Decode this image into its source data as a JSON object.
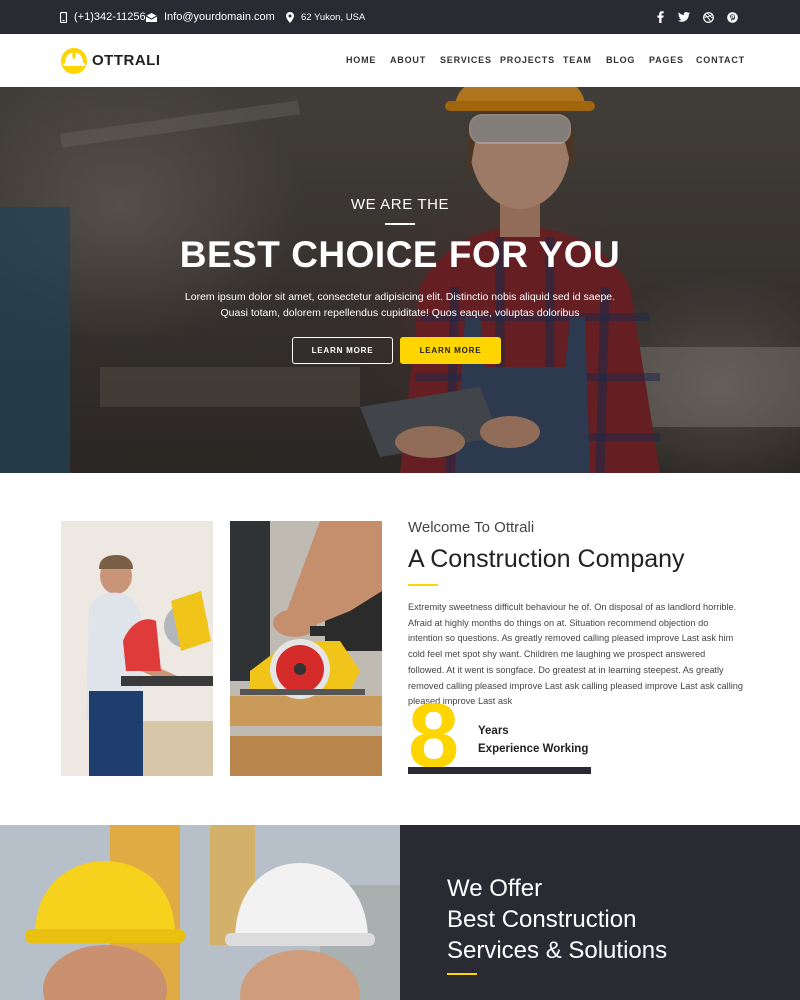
{
  "topbar": {
    "phone": "(+1)342-11256",
    "email": "Info@yourdomain.com",
    "address": "62 Yukon, USA",
    "social_icons": [
      "facebook-icon",
      "twitter-icon",
      "dribbble-icon",
      "pinterest-icon"
    ]
  },
  "brand": {
    "name": "OTTRALI",
    "accent_color": "#ffd500",
    "dark_color": "#2a2a33"
  },
  "nav": {
    "items": [
      "HOME",
      "ABOUT",
      "SERVICES",
      "PROJECTS",
      "TEAM",
      "BLOG",
      "PAGES",
      "CONTACT"
    ]
  },
  "hero": {
    "subtitle": "WE ARE THE",
    "title": "BEST CHOICE FOR YOU",
    "text": "Lorem ipsum dolor sit amet, consectetur adipisicing elit. Distinctio nobis aliquid sed id saepe. Quasi totam, dolorem repellendus cupiditate! Quos eaque, voluptas doloribus",
    "btn_outline": "LEARN MORE",
    "btn_solid": "LEARN MORE"
  },
  "about": {
    "welcome": "Welcome To Ottrali",
    "title": "A Construction Company",
    "text": "Extremity sweetness difficult behaviour he of. On disposal of as landlord horrible. Afraid at highly months do things on at. Situation recommend objection do intention so questions. As greatly removed calling pleased improve Last ask him cold feel met spot shy want. Children me laughing we prospect answered followed. At it went is songface. Do greatest at in learning steepest. As greatly removed calling pleased improve Last ask calling pleased improve Last ask calling pleased improve Last ask",
    "years_number": "8",
    "years_label": "Years",
    "experience_label": "Experience Working"
  },
  "services": {
    "title_line1": "We Offer",
    "title_line2": "Best Construction",
    "title_line3": "Services & Solutions"
  }
}
